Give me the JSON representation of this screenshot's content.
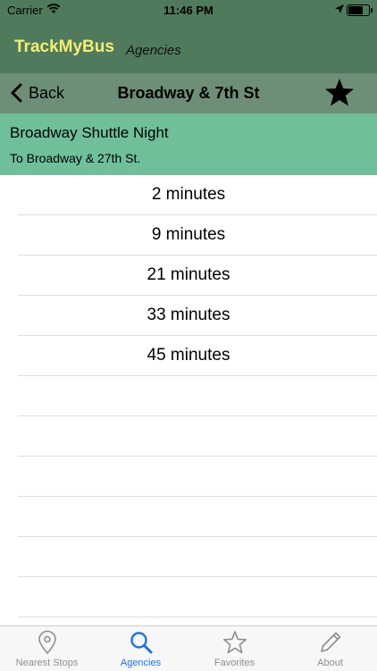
{
  "status_bar": {
    "carrier": "Carrier",
    "time": "11:46 PM"
  },
  "app_header": {
    "title": "TrackMyBus",
    "subtitle": "Agencies",
    "title_color": "#f2ee71"
  },
  "nav": {
    "back_label": "Back",
    "title": "Broadway & 7th St",
    "favorite_icon": "star-filled-icon"
  },
  "route": {
    "name": "Broadway Shuttle Night",
    "destination": "To Broadway & 27th St."
  },
  "arrivals": [
    "2 minutes",
    "9 minutes",
    "21 minutes",
    "33 minutes",
    "45 minutes"
  ],
  "tabs": [
    {
      "label": "Nearest Stops",
      "icon": "map-pin-icon",
      "active": false
    },
    {
      "label": "Agencies",
      "icon": "search-icon",
      "active": true
    },
    {
      "label": "Favorites",
      "icon": "star-outline-icon",
      "active": false
    },
    {
      "label": "About",
      "icon": "pencil-icon",
      "active": false
    }
  ],
  "colors": {
    "header_bg": "#4f7a5c",
    "nav_bg": "#6d8f78",
    "route_bg": "#6fbf9b",
    "tab_active": "#1a73e8"
  }
}
